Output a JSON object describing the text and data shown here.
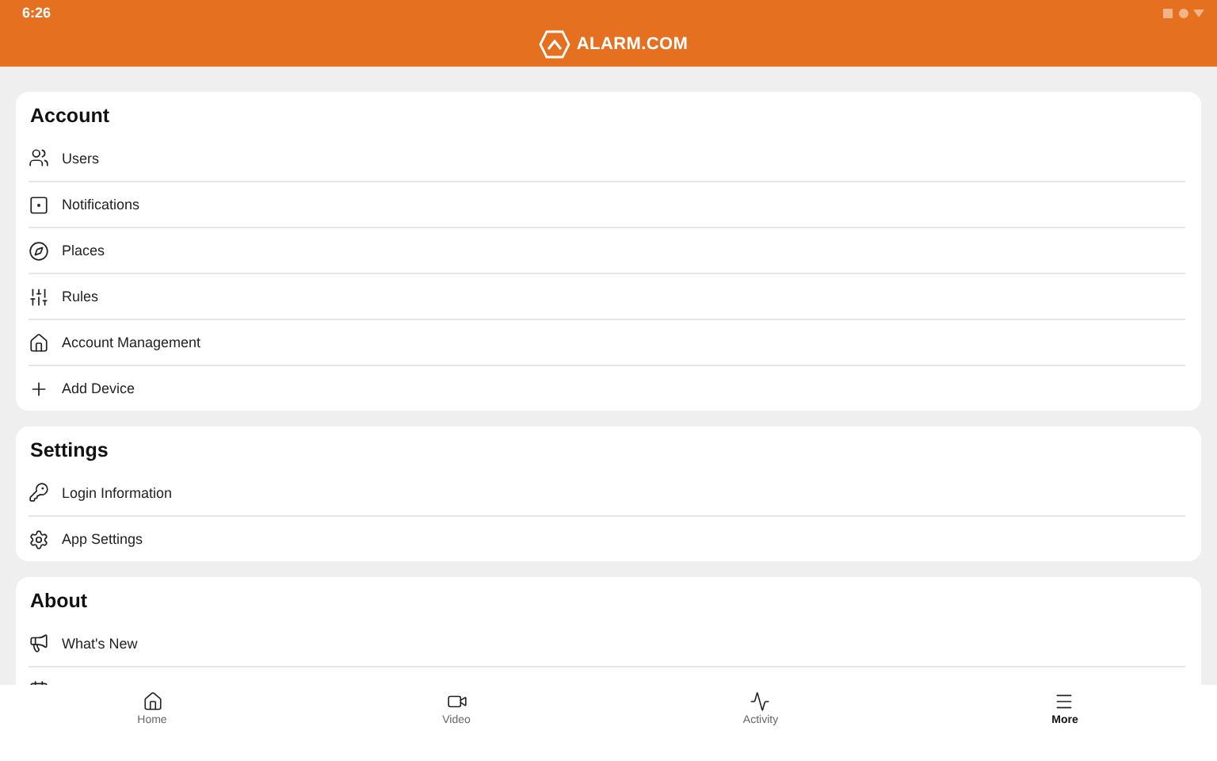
{
  "status_bar": {
    "time": "6:26"
  },
  "header": {
    "logo": "ALARM.COM"
  },
  "sections": [
    {
      "title": "Account",
      "items": [
        {
          "label": "Users"
        },
        {
          "label": "Notifications"
        },
        {
          "label": "Places"
        },
        {
          "label": "Rules"
        },
        {
          "label": "Account Management"
        },
        {
          "label": "Add Device"
        }
      ]
    },
    {
      "title": "Settings",
      "items": [
        {
          "label": "Login Information"
        },
        {
          "label": "App Settings"
        }
      ]
    },
    {
      "title": "About",
      "items": [
        {
          "label": "What's New"
        }
      ]
    }
  ],
  "bottom_nav": [
    {
      "label": "Home",
      "selected": false
    },
    {
      "label": "Video",
      "selected": false
    },
    {
      "label": "Activity",
      "selected": false
    },
    {
      "label": "More",
      "selected": true
    }
  ]
}
